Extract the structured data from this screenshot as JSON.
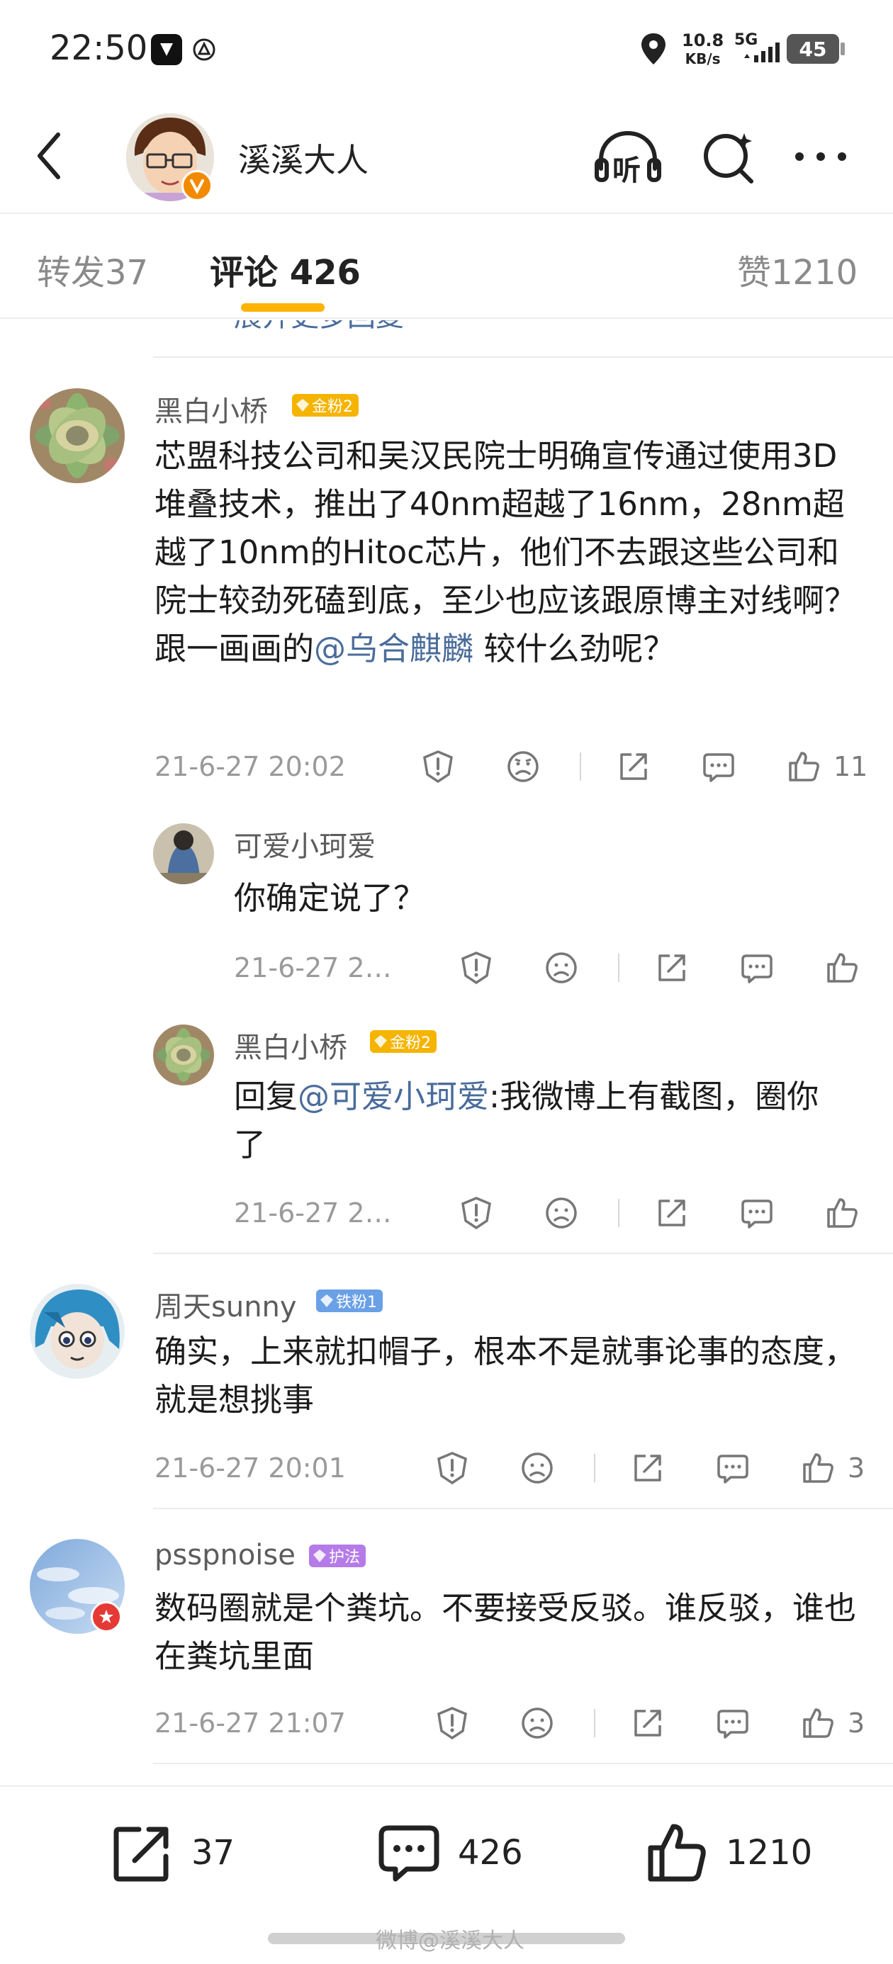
{
  "status": {
    "time": "22:50",
    "net_speed_top": "10.8",
    "net_speed_unit": "KB/s",
    "signal": "5G",
    "battery": "45"
  },
  "header": {
    "user_name": "溪溪大人",
    "listen_label": "听"
  },
  "tabs": [
    {
      "label": "转发",
      "count": "37"
    },
    {
      "label": "评论",
      "count": "426"
    },
    {
      "label": "赞",
      "count": "1210"
    }
  ],
  "truncated_link": "展开更多回复",
  "comments": [
    {
      "user": "黑白小桥",
      "badge": "金粉2",
      "badge_color": "#f5b400",
      "text_main": "芯盟科技公司和吴汉民院士明确宣传通过使用3D堆叠技术，推出了40nm超越了16nm，28nm超越了10nm的Hitoc芯片，他们不去跟这些公司和院士较劲死磕到底，至少也应该跟原博主对线啊？跟一画画的",
      "mention": "@乌合麒麟",
      "text_tail": " 较什么劲呢？",
      "time": "21-6-27 20:02",
      "likes": "11",
      "replies": [
        {
          "user": "可爱小珂爱",
          "text": "你确定说了？",
          "time": "21-6-27 2…"
        },
        {
          "user": "黑白小桥",
          "badge": "金粉2",
          "prefix": "回复",
          "mention": "@可爱小珂爱",
          "text": ":我微博上有截图，圈你了",
          "time": "21-6-27 2…"
        }
      ]
    },
    {
      "user": "周天sunny",
      "badge": "铁粉1",
      "badge_color": "#6aa0e6",
      "text": "确实，上来就扣帽子，根本不是就事论事的态度，就是想挑事",
      "time": "21-6-27 20:01",
      "likes": "3"
    },
    {
      "user": "psspnoise",
      "badge": "护法",
      "badge_color": "#b57be8",
      "text": "数码圈就是个粪坑。不要接受反驳。谁反驳，谁也在粪坑里面",
      "time": "21-6-27 21:07",
      "likes": "3"
    }
  ],
  "bottom_bar": {
    "repost": "37",
    "comment": "426",
    "like": "1210"
  },
  "watermark": "微博@溪溪大人",
  "icons": [
    "back-icon",
    "verified-icon",
    "listen-icon",
    "search-icon",
    "more-icon",
    "report-icon",
    "dislike-icon",
    "share-icon",
    "reply-icon",
    "like-icon"
  ]
}
